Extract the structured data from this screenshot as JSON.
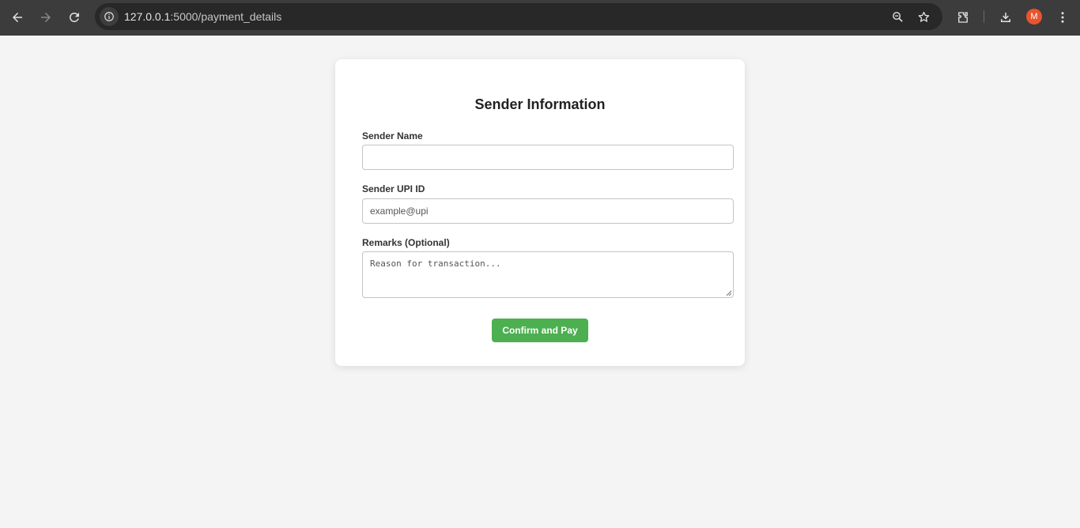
{
  "browser": {
    "url_host": "127.0.0.1",
    "url_rest": ":5000/payment_details",
    "profile_initial": "M",
    "profile_color": "#e8542e"
  },
  "form": {
    "title": "Sender Information",
    "sender_name": {
      "label": "Sender Name",
      "value": "",
      "placeholder": ""
    },
    "sender_upi": {
      "label": "Sender UPI ID",
      "value": "",
      "placeholder": "example@upi"
    },
    "remarks": {
      "label": "Remarks (Optional)",
      "value": "",
      "placeholder": "Reason for transaction..."
    },
    "submit_label": "Confirm and Pay",
    "accent_color": "#4caf50"
  }
}
